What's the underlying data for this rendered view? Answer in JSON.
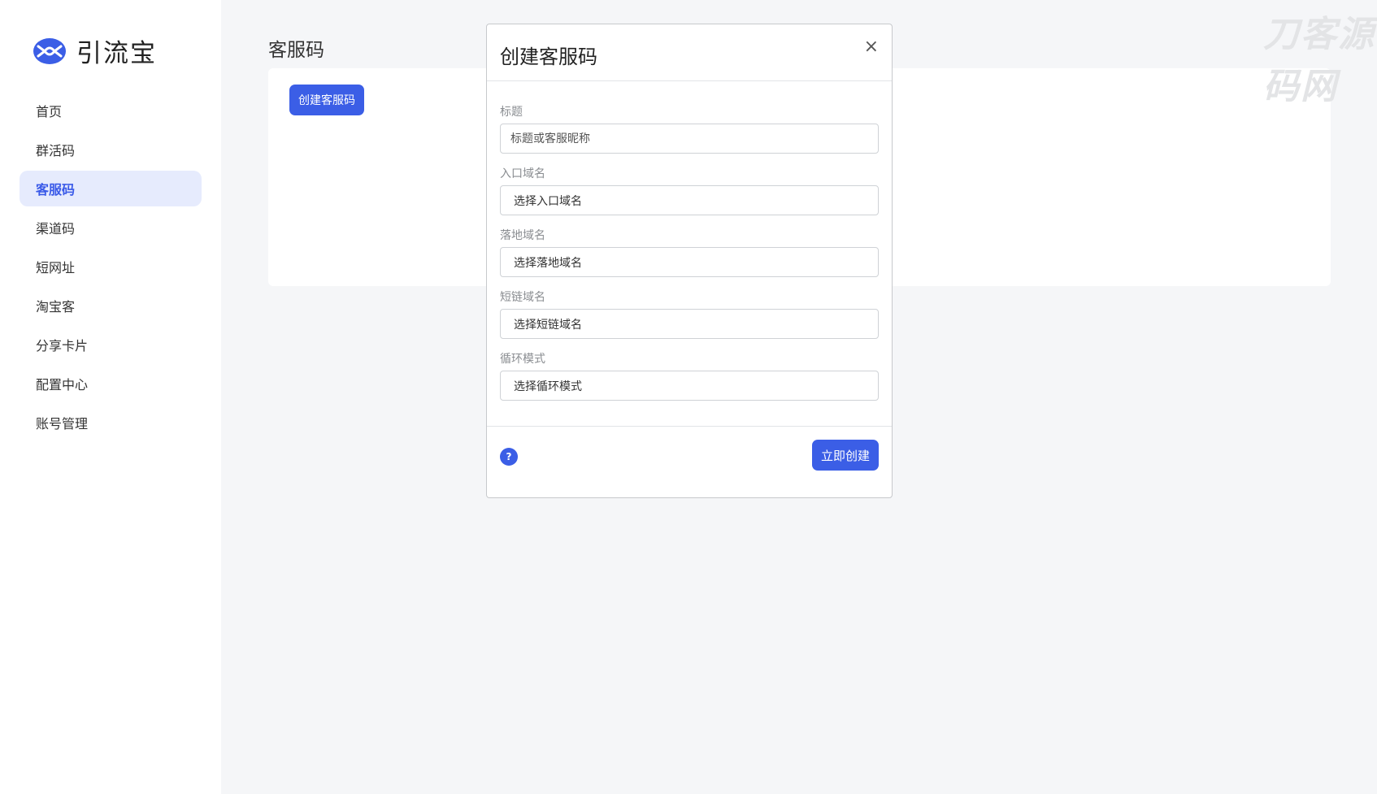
{
  "app": {
    "name": "引流宝"
  },
  "sidebar": {
    "items": [
      {
        "label": "首页"
      },
      {
        "label": "群活码"
      },
      {
        "label": "客服码",
        "active": true
      },
      {
        "label": "渠道码"
      },
      {
        "label": "短网址"
      },
      {
        "label": "淘宝客"
      },
      {
        "label": "分享卡片"
      },
      {
        "label": "配置中心"
      },
      {
        "label": "账号管理"
      }
    ]
  },
  "page": {
    "title": "客服码",
    "create_button": "创建客服码"
  },
  "watermark": "刀客源码网",
  "modal": {
    "title": "创建客服码",
    "close": "×",
    "fields": {
      "title": {
        "label": "标题",
        "placeholder": "标题或客服昵称"
      },
      "entry_domain": {
        "label": "入口域名",
        "value": "选择入口域名"
      },
      "landing_domain": {
        "label": "落地域名",
        "value": "选择落地域名"
      },
      "short_domain": {
        "label": "短链域名",
        "value": "选择短链域名"
      },
      "loop_mode": {
        "label": "循环模式",
        "value": "选择循环模式"
      }
    },
    "help": "?",
    "submit": "立即创建"
  },
  "colors": {
    "accent": "#3b5ee6",
    "active_bg": "#e6ebfd",
    "background": "#f5f6f8"
  }
}
